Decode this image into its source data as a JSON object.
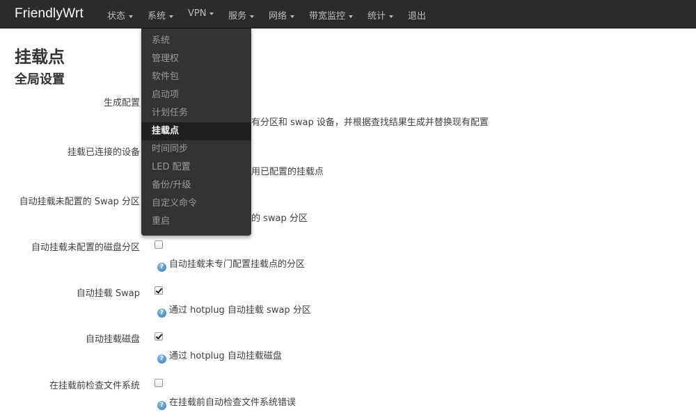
{
  "navbar": {
    "brand": "FriendlyWrt",
    "menus": [
      {
        "label": "状态",
        "has_caret": true
      },
      {
        "label": "系统",
        "has_caret": true
      },
      {
        "label": "VPN",
        "has_caret": true
      },
      {
        "label": "服务",
        "has_caret": true
      },
      {
        "label": "网络",
        "has_caret": true
      },
      {
        "label": "带宽监控",
        "has_caret": true
      },
      {
        "label": "统计",
        "has_caret": true
      },
      {
        "label": "退出",
        "has_caret": false
      }
    ]
  },
  "dropdown": {
    "items": [
      "系统",
      "管理权",
      "软件包",
      "启动项",
      "计划任务",
      "挂载点",
      "时间同步",
      "LED 配置",
      "备份/升级",
      "自定义命令",
      "重启"
    ],
    "active": "挂载点"
  },
  "page": {
    "title": "挂载点",
    "section_title": "全局设置"
  },
  "settings": [
    {
      "label": "生成配置",
      "checked": null,
      "help": "有分区和 swap 设备，并根据查找结果生成并替换现有配置"
    },
    {
      "label": "挂载已连接的设备",
      "checked": null,
      "help": "用已配置的挂载点"
    },
    {
      "label": "自动挂载未配置的 Swap 分区",
      "checked": null,
      "help": "的 swap 分区"
    },
    {
      "label": "自动挂载未配置的磁盘分区",
      "checked": false,
      "help": "自动挂载未专门配置挂载点的分区"
    },
    {
      "label": "自动挂载 Swap",
      "checked": true,
      "help": "通过 hotplug 自动挂载 swap 分区"
    },
    {
      "label": "自动挂载磁盘",
      "checked": true,
      "help": "通过 hotplug 自动挂载磁盘"
    },
    {
      "label": "在挂载前检查文件系统",
      "checked": false,
      "help": "在挂载前自动检查文件系统错误"
    }
  ],
  "icons": {
    "help": "help-question-icon",
    "caret": "caret-down-icon"
  },
  "colors": {
    "navbar_bg": "#2b2b2b",
    "dropdown_bg": "#333333",
    "active_item_bg": "#1f1f1f",
    "help_icon": "#2f73b8"
  }
}
